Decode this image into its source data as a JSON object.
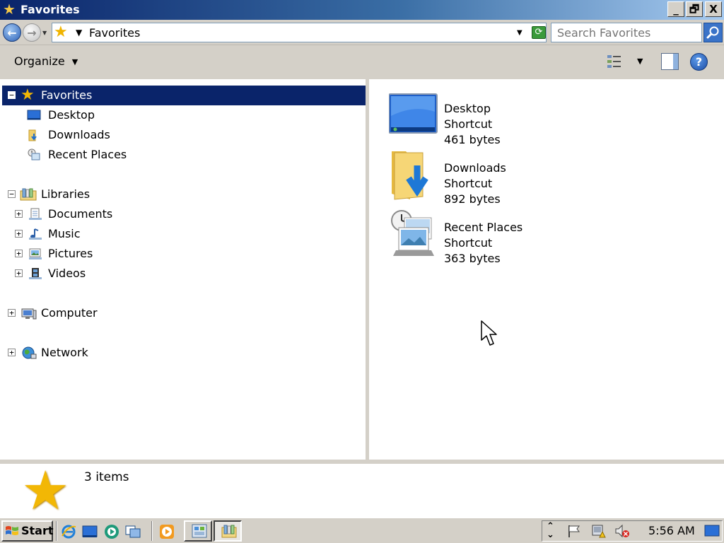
{
  "window": {
    "title": "Favorites",
    "buttons": {
      "minimize": "_",
      "restore": "🗗",
      "close": "X"
    }
  },
  "address": {
    "path": "Favorites",
    "search_placeholder": "Search Favorites"
  },
  "toolbar": {
    "organize_label": "Organize",
    "help_label": "?"
  },
  "navigation": {
    "favorites": {
      "label": "Favorites",
      "items": [
        {
          "label": "Desktop",
          "icon": "desktop-icon"
        },
        {
          "label": "Downloads",
          "icon": "downloads-folder-icon"
        },
        {
          "label": "Recent Places",
          "icon": "recent-places-icon"
        }
      ]
    },
    "libraries": {
      "label": "Libraries",
      "items": [
        {
          "label": "Documents",
          "icon": "documents-icon"
        },
        {
          "label": "Music",
          "icon": "music-icon"
        },
        {
          "label": "Pictures",
          "icon": "pictures-icon"
        },
        {
          "label": "Videos",
          "icon": "videos-icon"
        }
      ]
    },
    "computer": {
      "label": "Computer",
      "icon": "computer-icon"
    },
    "network": {
      "label": "Network",
      "icon": "network-icon"
    }
  },
  "files": [
    {
      "name": "Desktop",
      "type": "Shortcut",
      "size": "461 bytes",
      "icon": "desktop-icon"
    },
    {
      "name": "Downloads",
      "type": "Shortcut",
      "size": "892 bytes",
      "icon": "downloads-folder-icon"
    },
    {
      "name": "Recent Places",
      "type": "Shortcut",
      "size": "363 bytes",
      "icon": "recent-places-icon"
    }
  ],
  "details": {
    "item_count": "3 items"
  },
  "taskbar": {
    "start_label": "Start",
    "clock": "5:56 AM"
  },
  "colors": {
    "selection": "#0a246a",
    "face": "#d4d0c8",
    "accent_blue": "#3a73c8",
    "star_gold": "#f2b705"
  }
}
